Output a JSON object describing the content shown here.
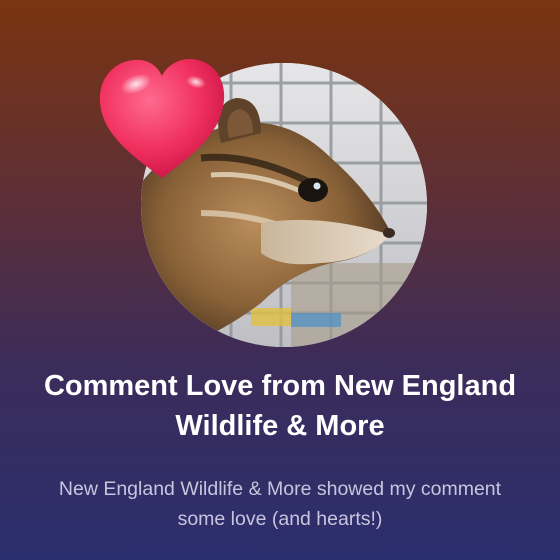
{
  "card": {
    "title": "Comment Love from New England Wildlife & More",
    "description": "New England Wildlife & More showed my comment some love (and hearts!)"
  },
  "icons": {
    "heart": "heart-icon",
    "photo": "chipmunk-photo"
  },
  "colors": {
    "background_top": "#7a3410",
    "background_bottom": "#2a2f6e",
    "heart": "#f0305f",
    "title": "#ffffff",
    "subtitle": "#c9c4de"
  }
}
